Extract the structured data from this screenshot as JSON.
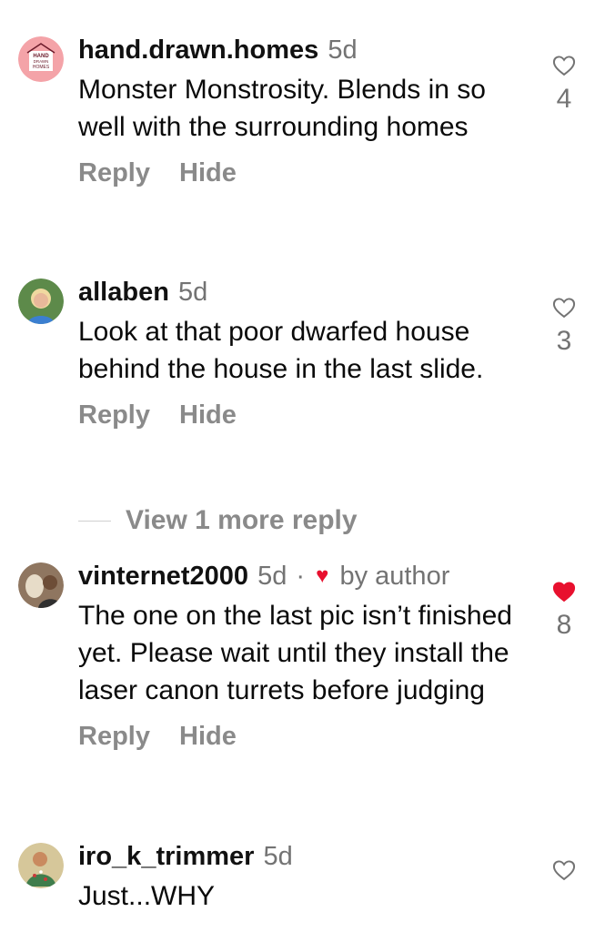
{
  "comments": [
    {
      "username": "hand.drawn.homes",
      "time": "5d",
      "text": "Monster Monstrosity. Blends in so well with the surrounding homes",
      "reply_label": "Reply",
      "hide_label": "Hide",
      "likes": "4",
      "avatar_text": [
        "HAND",
        "DRAWN",
        "HOMES"
      ],
      "liked": false
    },
    {
      "username": "allaben",
      "time": "5d",
      "text": "Look at that poor dwarfed house behind the house in the last slide.",
      "reply_label": "Reply",
      "hide_label": "Hide",
      "likes": "3",
      "liked": false
    },
    {
      "username": "vinternet2000",
      "time": "5d",
      "separator": "·",
      "author_badge": "by author",
      "text": "The one on the last pic isn’t finished yet. Please wait until they install the laser canon turrets before judging",
      "reply_label": "Reply",
      "hide_label": "Hide",
      "likes": "8",
      "liked": true
    },
    {
      "username": "iro_k_trimmer",
      "time": "5d",
      "text": "Just...WHY",
      "liked": false
    }
  ],
  "view_more_label": "View 1 more reply",
  "colors": {
    "liked_heart": "#e8102e",
    "secondary_text": "#737373",
    "action_text": "#8a8a8a"
  }
}
